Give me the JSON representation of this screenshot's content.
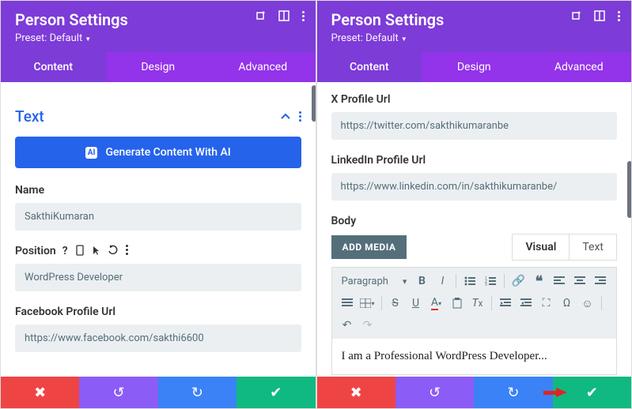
{
  "left": {
    "title": "Person Settings",
    "preset": "Preset: Default",
    "tabs": {
      "content": "Content",
      "design": "Design",
      "advanced": "Advanced"
    },
    "section": "Text",
    "ai_label": "Generate Content With AI",
    "name_label": "Name",
    "name_value": "SakthiKumaran",
    "position_label": "Position",
    "position_value": "WordPress Developer",
    "fb_label": "Facebook Profile Url",
    "fb_value": "https://www.facebook.com/sakthi6600"
  },
  "right": {
    "title": "Person Settings",
    "preset": "Preset: Default",
    "tabs": {
      "content": "Content",
      "design": "Design",
      "advanced": "Advanced"
    },
    "x_label": "X Profile Url",
    "x_value": "https://twitter.com/sakthikumaranbe",
    "li_label": "LinkedIn Profile Url",
    "li_value": "https://www.linkedin.com/in/sakthikumaranbe/",
    "body_label": "Body",
    "add_media": "ADD MEDIA",
    "visual": "Visual",
    "text": "Text",
    "paragraph": "Paragraph",
    "body_content": "I am a Professional WordPress Developer..."
  }
}
